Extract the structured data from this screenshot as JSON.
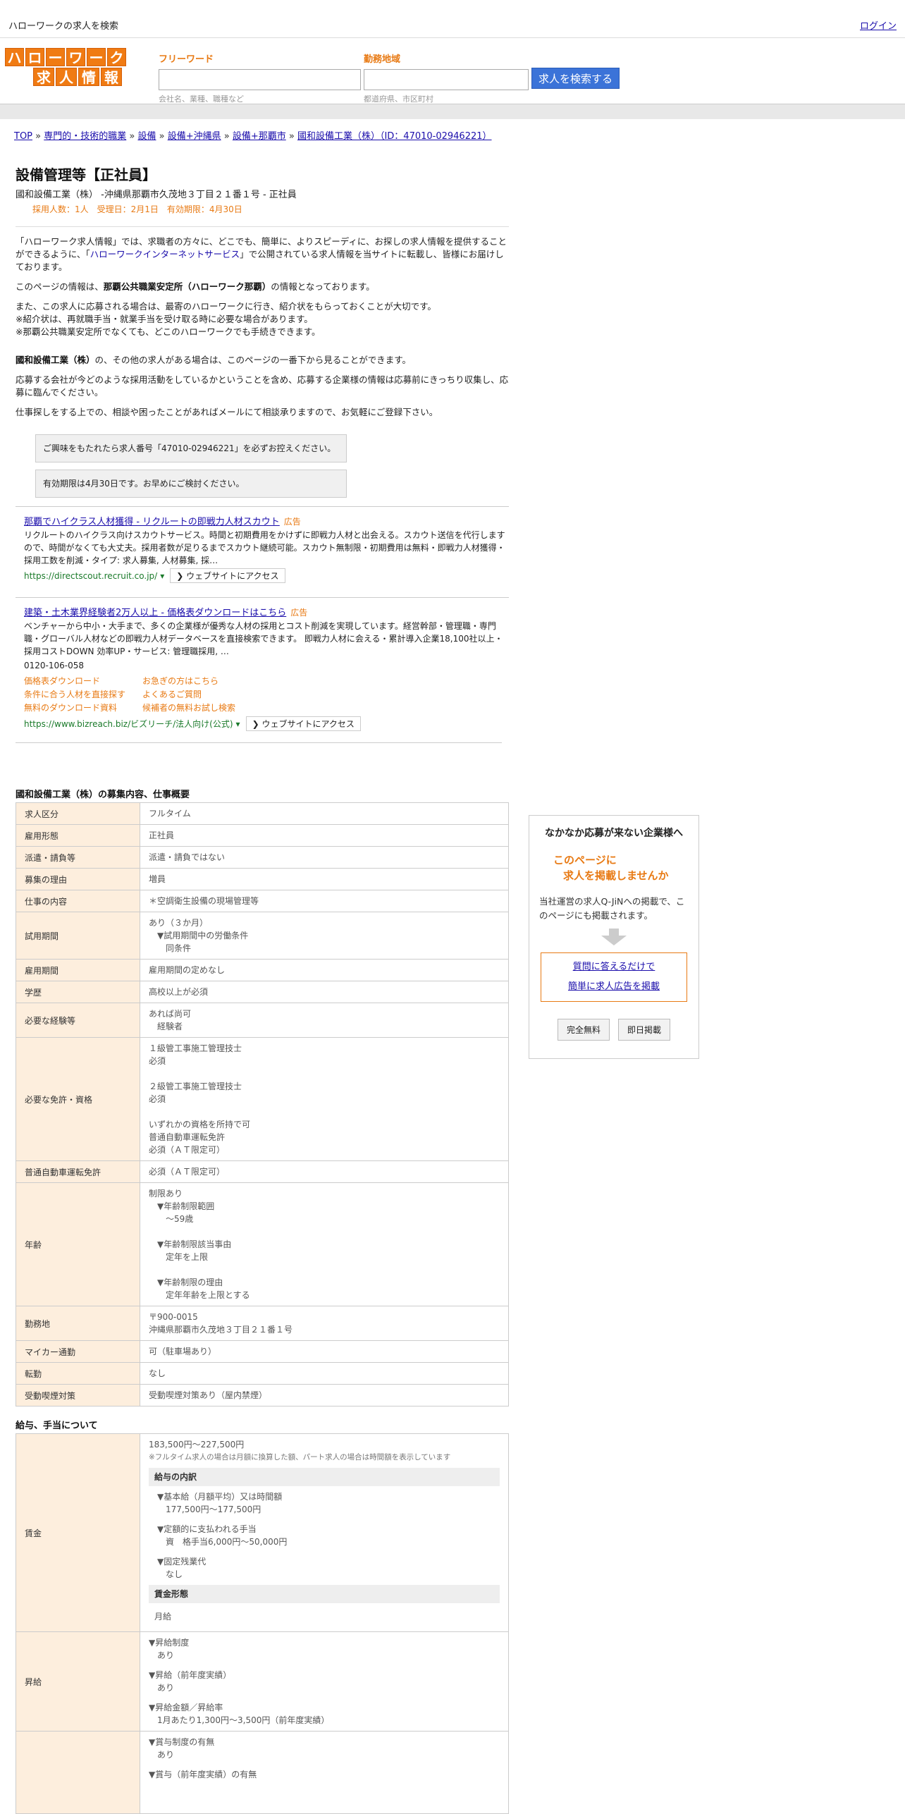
{
  "topbar": {
    "title": "ハローワークの求人を検索",
    "login": "ログイン"
  },
  "logo": {
    "row1": [
      "ハ",
      "ロ",
      "ー",
      "ワ",
      "ー",
      "ク"
    ],
    "row2": [
      "求",
      "人",
      "情",
      "報"
    ]
  },
  "search": {
    "free_label": "フリーワード",
    "free_placeholder": "会社名、業種、職種など",
    "area_label": "勤務地域",
    "area_placeholder": "都道府県、市区町村",
    "button": "求人を検索する"
  },
  "breadcrumbs": [
    {
      "label": "TOP"
    },
    {
      "label": "専門的・技術的職業"
    },
    {
      "label": "設備"
    },
    {
      "label": "設備+沖縄県"
    },
    {
      "label": "設備+那覇市"
    },
    {
      "label": "國和設備工業（株）（ID：47010-02946221）"
    }
  ],
  "job": {
    "title": "設備管理等【正社員】",
    "company_line": "國和設備工業（株） -沖縄県那覇市久茂地３丁目２１番１号 - 正社員",
    "meta": "採用人数：1人　受理日：2月1日　有効期限：4月30日"
  },
  "intro": {
    "p1a": "「ハローワーク求人情報」では、求職者の方々に、どこでも、簡単に、よりスピーディに、お探しの求人情報を提供することができるように、「",
    "p1link": "ハローワークインターネットサービス",
    "p1b": "」で公開されている求人情報を当サイトに転載し、皆様にお届けしております。",
    "p2a": "このページの情報は、",
    "p2b": "那覇公共職業安定所（ハローワーク那覇）",
    "p2c": "の情報となっております。",
    "p3": "また、この求人に応募される場合は、最寄のハローワークに行き、紹介状をもらっておくことが大切です。",
    "p3b": "※紹介状は、再就職手当・就業手当を受け取る時に必要な場合があります。",
    "p3c": "※那覇公共職業安定所でなくても、どこのハローワークでも手続きできます。",
    "p4a": "國和設備工業（株）",
    "p4b": "の、その他の求人がある場合は、このページの一番下から見ることができます。",
    "p5": "応募する会社が今どのような採用活動をしているかということを含め、応募する企業様の情報は応募前にきっちり収集し、応募に臨んでください。",
    "p6": "仕事探しをする上での、相談や困ったことがあればメールにて相談承りますので、お気軽にご登録下さい。",
    "notice1": "ご興味をもたれたら求人番号「47010-02946221」を必ずお控えください。",
    "notice2": "有効期限は4月30日です。お早めにご検討ください。"
  },
  "ads": [
    {
      "title": "那覇でハイクラス人材獲得 - リクルートの即戦力人材スカウト",
      "tag": "広告",
      "desc": "リクルートのハイクラス向けスカウトサービス。時間と初期費用をかけずに即戦力人材と出会える。スカウト送信を代行しますので、時間がなくても大丈夫。採用者数が足りるまでスカウト継続可能。スカウト無制限・初期費用は無料・即戦力人材獲得・採用工数を削減・タイプ: 求人募集, 人材募集, 採…",
      "url": "https://directscout.recruit.co.jp/",
      "visit": "❯ ウェブサイトにアクセス"
    },
    {
      "title": "建築・土木業界経験者2万人以上 - 価格表ダウンロードはこちら",
      "tag": "広告",
      "desc": "ベンチャーから中小・大手まで、多くの企業様が優秀な人材の採用とコスト削減を実現しています。経営幹部・管理職・専門職・グローバル人材などの即戦力人材データベースを直接検索できます。 即戦力人材に会える・累計導入企業18,100社以上・採用コストDOWN 効率UP・サービス: 管理職採用, …",
      "phone": "0120-106-058",
      "sitelinks": [
        "価格表ダウンロード",
        "お急ぎの方はこちら",
        "条件に合う人材を直接探す",
        "よくあるご質問",
        "無料のダウンロード資料",
        "候補者の無料お試し検索"
      ],
      "url": "https://www.bizreach.biz/ビズリーチ/法人向け(公式)",
      "visit": "❯ ウェブサイトにアクセス"
    }
  ],
  "recruit": {
    "section_title": "國和設備工業（株）の募集内容、仕事概要",
    "rows": [
      {
        "k": "求人区分",
        "v": [
          "フルタイム"
        ]
      },
      {
        "k": "雇用形態",
        "v": [
          "正社員"
        ]
      },
      {
        "k": "派遣・請負等",
        "v": [
          "派遣・請負ではない"
        ]
      },
      {
        "k": "募集の理由",
        "v": [
          "増員"
        ]
      },
      {
        "k": "仕事の内容",
        "v": [
          "＊空調衛生設備の現場管理等"
        ]
      },
      {
        "k": "試用期間",
        "v": [
          "あり（３か月）",
          "▼試用期間中の労働条件",
          "同条件"
        ]
      },
      {
        "k": "雇用期間",
        "v": [
          "雇用期間の定めなし"
        ]
      },
      {
        "k": "学歴",
        "v": [
          "高校以上が必須"
        ]
      },
      {
        "k": "必要な経験等",
        "v": [
          "あれば尚可",
          "経験者"
        ]
      },
      {
        "k": "必要な免許・資格",
        "v": [
          "１級管工事施工管理技士",
          "必須",
          "",
          "２級管工事施工管理技士",
          "必須",
          "",
          "いずれかの資格を所持で可",
          "普通自動車運転免許",
          "必須（ＡＴ限定可）"
        ]
      },
      {
        "k": "普通自動車運転免許",
        "v": [
          "必須（ＡＴ限定可）"
        ]
      },
      {
        "k": "年齢",
        "v": [
          "制限あり",
          "▼年齢制限範囲",
          "〜59歳",
          "",
          "▼年齢制限該当事由",
          "定年を上限",
          "",
          "▼年齢制限の理由",
          "定年年齢を上限とする"
        ]
      },
      {
        "k": "勤務地",
        "v": [
          "〒900-0015",
          "沖縄県那覇市久茂地３丁目２１番１号"
        ]
      },
      {
        "k": "マイカー通勤",
        "v": [
          "可（駐車場あり）"
        ]
      },
      {
        "k": "転勤",
        "v": [
          "なし"
        ]
      },
      {
        "k": "受動喫煙対策",
        "v": [
          "受動喫煙対策あり（屋内禁煙）"
        ]
      }
    ]
  },
  "salary": {
    "section_title": "給与、手当について",
    "wage_label": "賃金",
    "wage_range": "183,500円〜227,500円",
    "wage_note": "※フルタイム求人の場合は月額に換算した額、パート求人の場合は時間額を表示しています",
    "breakdown_title": "給与の内訳",
    "b1": "▼基本給（月額平均）又は時間額",
    "b1v": "177,500円〜177,500円",
    "b2": "▼定額的に支払われる手当",
    "b2v": "資　格手当6,000円〜50,000円",
    "b3": "▼固定残業代",
    "b3v": "なし",
    "form_title": "賃金形態",
    "form_v": "月給",
    "raise_label": "昇給",
    "r1": "▼昇給制度",
    "r1v": "あり",
    "r2": "▼昇給（前年度実績）",
    "r2v": "あり",
    "r3": "▼昇給金額／昇給率",
    "r3v": "1月あたり1,300円〜3,500円（前年度実績）",
    "bonus1": "▼賞与制度の有無",
    "bonus1v": "あり",
    "bonus2": "▼賞与（前年度実績）の有無"
  },
  "side": {
    "title": "なかなか応募が来ない企業様へ",
    "orange1": "このページに",
    "orange2": "求人を掲載しませんか",
    "text": "当社運営の求人Q-JiNへの掲載で、このページにも掲載されます。",
    "link1": "質問に答えるだけで",
    "link2": "簡単に求人広告を掲載",
    "btn1": "完全無料",
    "btn2": "即日掲載"
  }
}
